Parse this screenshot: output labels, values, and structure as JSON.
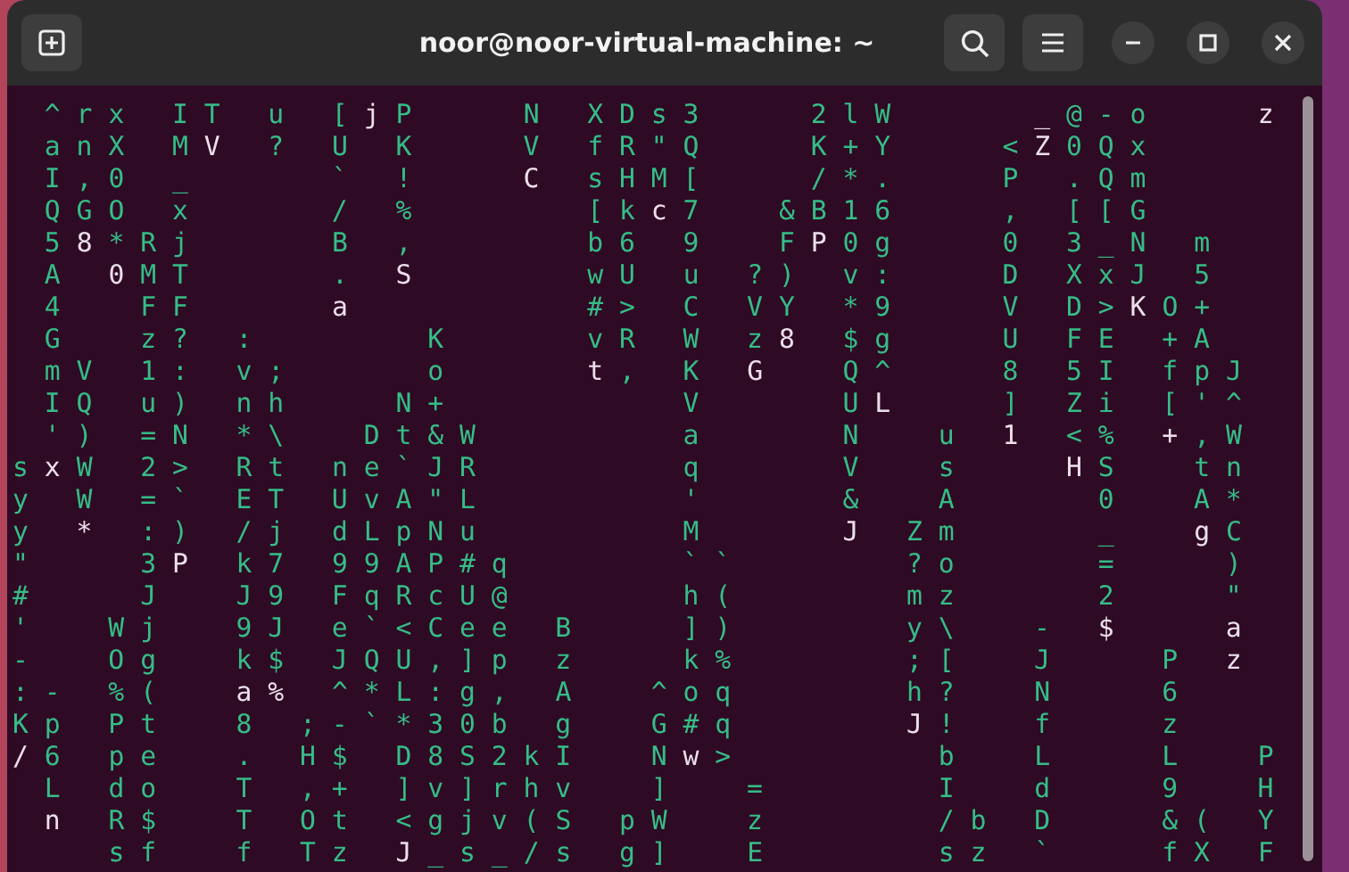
{
  "window": {
    "title": "noor@noor-virtual-machine: ~"
  },
  "terminal": {
    "lines": [
      {
        "runs": [
          {
            "text": "  ^ r x   I T   u   [ ",
            "head": false
          },
          {
            "text": "j",
            "head": true
          },
          {
            "text": " P       N   X D s 3       2 l W         ",
            "head": false
          },
          {
            "text": "_",
            "head": true
          },
          {
            "text": " @ - o       ",
            "head": false
          },
          {
            "text": "z",
            "head": true
          }
        ]
      },
      {
        "runs": [
          {
            "text": "  a n X   M ",
            "head": false
          },
          {
            "text": "V",
            "head": true
          },
          {
            "text": "   ?   U   K       V   f R \" Q       K + Y       < ",
            "head": false
          },
          {
            "text": "Z",
            "head": true
          },
          {
            "text": " 0 Q x",
            "head": false
          }
        ]
      },
      {
        "runs": [
          {
            "text": "  I , 0   _         `   !       ",
            "head": false
          },
          {
            "text": "C",
            "head": true
          },
          {
            "text": "   s H M [       / * .       P   . Q m",
            "head": false
          }
        ]
      },
      {
        "runs": [
          {
            "text": "  Q G O   x         /   %           [ k ",
            "head": false
          },
          {
            "text": "c",
            "head": true
          },
          {
            "text": " 7     & B 1 6       ,   [ [ G",
            "head": false
          }
        ]
      },
      {
        "runs": [
          {
            "text": "  5 ",
            "head": false
          },
          {
            "text": "8",
            "head": true
          },
          {
            "text": " * R j         B   ,           b 6   9     F ",
            "head": false
          },
          {
            "text": "P",
            "head": true
          },
          {
            "text": " 0 g       0   3 _ N   m",
            "head": false
          }
        ]
      },
      {
        "runs": [
          {
            "text": "  A   ",
            "head": false
          },
          {
            "text": "0",
            "head": true
          },
          {
            "text": " M T         .   ",
            "head": false
          },
          {
            "text": "S",
            "head": true
          },
          {
            "text": "           w U   u   ? )   v :       D   X x J   5",
            "head": false
          }
        ]
      },
      {
        "runs": [
          {
            "text": "  4     F F         ",
            "head": false
          },
          {
            "text": "a",
            "head": true
          },
          {
            "text": "               # >   C   V Y   * 9       V   D > ",
            "head": false
          },
          {
            "text": "K",
            "head": true
          },
          {
            "text": " O +",
            "head": false
          }
        ]
      },
      {
        "runs": [
          {
            "text": "  G     z ?   :           K         v R   W   z ",
            "head": false
          },
          {
            "text": "8",
            "head": true
          },
          {
            "text": "   $ g       U   F E   + A",
            "head": false
          }
        ]
      },
      {
        "runs": [
          {
            "text": "  m V   1 :   v ;         o         ",
            "head": false
          },
          {
            "text": "t",
            "head": true
          },
          {
            "text": " ,   K   ",
            "head": false
          },
          {
            "text": "G",
            "head": true
          },
          {
            "text": "     Q ^       8   5 I   f p J",
            "head": false
          }
        ]
      },
      {
        "runs": [
          {
            "text": "  I Q   u )   n h       N +               V         U ",
            "head": false
          },
          {
            "text": "L",
            "head": true
          },
          {
            "text": "       ]   Z i   [ ' ^",
            "head": false
          }
        ]
      },
      {
        "runs": [
          {
            "text": "  ' )   = N   * \\     D t & W             a         N     u   ",
            "head": false
          },
          {
            "text": "1",
            "head": true
          },
          {
            "text": "   < %   ",
            "head": false
          },
          {
            "text": "+",
            "head": true
          },
          {
            "text": " , W",
            "head": false
          }
        ]
      },
      {
        "runs": [
          {
            "text": "s ",
            "head": false
          },
          {
            "text": "x",
            "head": true
          },
          {
            "text": " W   2 >   R t   n e ` J R             q         V     s       ",
            "head": false
          },
          {
            "text": "H",
            "head": true
          },
          {
            "text": " S     t n",
            "head": false
          }
        ]
      },
      {
        "runs": [
          {
            "text": "y   W   = `   E T   U v A \" L             '         &     A         0     A *",
            "head": false
          }
        ]
      },
      {
        "runs": [
          {
            "text": "y   ",
            "head": false
          },
          {
            "text": "*",
            "head": true
          },
          {
            "text": "   : )   / j   d L p N u             M         ",
            "head": false
          },
          {
            "text": "J",
            "head": true
          },
          {
            "text": "   Z m         _     ",
            "head": false
          },
          {
            "text": "g",
            "head": true
          },
          {
            "text": " C",
            "head": false
          }
        ]
      },
      {
        "runs": [
          {
            "text": "\"       3 ",
            "head": false
          },
          {
            "text": "P",
            "head": true
          },
          {
            "text": "   k 7   9 9 A P # q           ` `           ? o         =       )",
            "head": false
          }
        ]
      },
      {
        "runs": [
          {
            "text": "#       J     J 9   F q R c U @           h (           m z         2       \"",
            "head": false
          }
        ]
      },
      {
        "runs": [
          {
            "text": "'     W j     9 J   e ` < C e e   B       ] )           y \\     -   ",
            "head": false
          },
          {
            "text": "$",
            "head": true
          },
          {
            "text": "       a",
            "head": true
          }
        ]
      },
      {
        "runs": [
          {
            "text": "-     O g     k $   J Q U , ] p   z       k %           ; [     J       P   ",
            "head": false
          },
          {
            "text": "z",
            "head": true
          }
        ]
      },
      {
        "runs": [
          {
            "text": ": -   % (     ",
            "head": false
          },
          {
            "text": "a",
            "head": true
          },
          {
            "text": " %",
            "head": true
          },
          {
            "text": "   ^ * L : g ,   A     ^ o q           h ?     N       6",
            "head": false
          }
        ]
      },
      {
        "runs": [
          {
            "text": "K p   P t     8   ; - ` * 3 0 b   g     G # q           ",
            "head": false
          },
          {
            "text": "J",
            "head": true
          },
          {
            "text": " !     f       z",
            "head": false
          }
        ]
      },
      {
        "runs": [
          {
            "text": "/",
            "head": true
          },
          {
            "text": " 6   p e     .   H $   D 8 S 2 k I     N ",
            "head": false
          },
          {
            "text": "w",
            "head": true
          },
          {
            "text": " >             b     L       L     P",
            "head": false
          }
        ]
      },
      {
        "runs": [
          {
            "text": "  L   d o     T   , +   ] v ] r h v     ]     =           I     d       9     H",
            "head": false
          }
        ]
      },
      {
        "runs": [
          {
            "text": "  n",
            "head": true
          },
          {
            "text": "   R $     T   O t   < g j v ( S   p W     z           / b   D       & (   Y",
            "head": false
          }
        ]
      },
      {
        "runs": [
          {
            "text": "      s f     f   T z   ",
            "head": false
          },
          {
            "text": "J",
            "head": true
          },
          {
            "text": " _ s _ / s   g ]     E           s z   `       f X   F",
            "head": false
          }
        ]
      }
    ]
  }
}
